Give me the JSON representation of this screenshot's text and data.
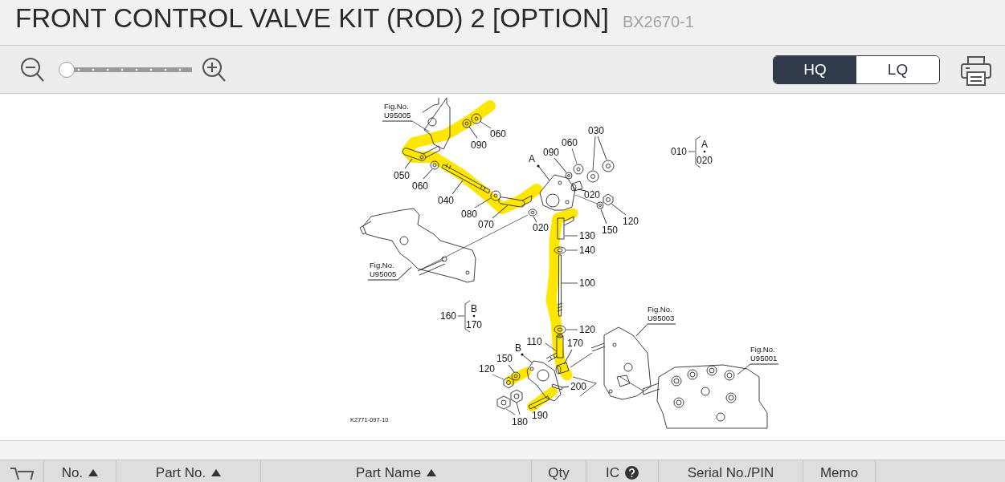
{
  "header": {
    "title": "FRONT CONTROL VALVE KIT (ROD) 2 [OPTION]",
    "code": "BX2670-1"
  },
  "toolbar": {
    "zoom": {
      "level": 0
    },
    "quality_options": [
      {
        "label": "HQ",
        "selected": true
      },
      {
        "label": "LQ",
        "selected": false
      }
    ]
  },
  "diagram": {
    "figure_refs": [
      {
        "label": "Fig.No.",
        "number": "U95005"
      },
      {
        "label": "Fig.No.",
        "number": "U95005"
      },
      {
        "label": "Fig.No.",
        "number": "U95003"
      },
      {
        "label": "Fig.No.",
        "number": "U95001"
      }
    ],
    "callouts": [
      {
        "kind": "number",
        "text": "060"
      },
      {
        "kind": "number",
        "text": "090"
      },
      {
        "kind": "number",
        "text": "050"
      },
      {
        "kind": "number",
        "text": "060"
      },
      {
        "kind": "number",
        "text": "040"
      },
      {
        "kind": "number",
        "text": "080"
      },
      {
        "kind": "number",
        "text": "070"
      },
      {
        "kind": "letter",
        "text": "A"
      },
      {
        "kind": "number",
        "text": "090"
      },
      {
        "kind": "number",
        "text": "060"
      },
      {
        "kind": "number",
        "text": "030"
      },
      {
        "kind": "number",
        "text": "020"
      },
      {
        "kind": "number",
        "text": "020"
      },
      {
        "kind": "number",
        "text": "150"
      },
      {
        "kind": "number",
        "text": "120"
      },
      {
        "kind": "number",
        "text": "130"
      },
      {
        "kind": "number",
        "text": "140"
      },
      {
        "kind": "number",
        "text": "100"
      },
      {
        "kind": "number",
        "text": "120"
      },
      {
        "kind": "number",
        "text": "110"
      },
      {
        "kind": "number",
        "text": "170"
      },
      {
        "kind": "letter",
        "text": "B"
      },
      {
        "kind": "number",
        "text": "150"
      },
      {
        "kind": "number",
        "text": "120"
      },
      {
        "kind": "number",
        "text": "200"
      },
      {
        "kind": "number",
        "text": "190"
      },
      {
        "kind": "number",
        "text": "180"
      }
    ],
    "group_marks": [
      {
        "number": "010",
        "letter": "A",
        "range_end": "020"
      },
      {
        "number": "160",
        "letter": "B",
        "range_end": "170"
      }
    ],
    "drawing_code": "K2771-097-10"
  },
  "table": {
    "columns": [
      {
        "kind": "cart"
      },
      {
        "kind": "sort",
        "label": "No."
      },
      {
        "kind": "sort",
        "label": "Part No."
      },
      {
        "kind": "sort",
        "label": "Part Name"
      },
      {
        "kind": "plain",
        "label": "Qty"
      },
      {
        "kind": "help",
        "label": "IC"
      },
      {
        "kind": "plain",
        "label": "Serial No./PIN"
      },
      {
        "kind": "plain",
        "label": "Memo"
      }
    ]
  }
}
